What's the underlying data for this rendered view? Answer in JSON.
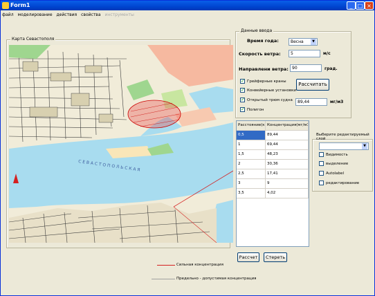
{
  "window": {
    "title": "Form1",
    "colors": {
      "titlebar": "#0a5fe8",
      "face": "#ece9d8"
    }
  },
  "menu": {
    "items": [
      "файл",
      "моделирование",
      "действия",
      "свойства"
    ],
    "disabled_item": "инструменты"
  },
  "map_panel": {
    "legend": "Карта Севастополя"
  },
  "input_panel": {
    "legend": "Данные ввода",
    "season_label": "Время года:",
    "season_value": "Весна",
    "wind_speed_label": "Скорость ветра:",
    "wind_speed_value": "5",
    "wind_speed_unit": "м/с",
    "wind_dir_label": "Направлени ветра:",
    "wind_dir_value": "90",
    "wind_dir_unit": "град.",
    "calc_button": "Рассчитать",
    "checkboxes": [
      {
        "label": "Грейферные краны",
        "checked": true
      },
      {
        "label": "Конвейерные установки",
        "checked": true
      },
      {
        "label": "Открытый трюм судна",
        "checked": true
      },
      {
        "label": "Полигон",
        "checked": true
      }
    ],
    "concentration_value": "89,44",
    "concentration_unit": "мг/м3"
  },
  "table": {
    "headers": [
      "Расстояние(км)",
      "Концентрация(мг/м3)"
    ],
    "rows": [
      [
        "0,5",
        "89,44"
      ],
      [
        "1",
        "69,44"
      ],
      [
        "1,5",
        "48,23"
      ],
      [
        "2",
        "30,36"
      ],
      [
        "2,5",
        "17,41"
      ],
      [
        "3",
        "9"
      ],
      [
        "3,5",
        "4,02"
      ]
    ]
  },
  "layers_panel": {
    "title": "Выберите редактируемый слой",
    "options": [
      {
        "label": "Видимость",
        "checked": false
      },
      {
        "label": "выделение",
        "checked": false
      },
      {
        "label": "Autolabel",
        "checked": false
      },
      {
        "label": "редактирование",
        "checked": false
      }
    ]
  },
  "buttons": {
    "calc": "Рассчет",
    "clear": "Стереть"
  },
  "legend": {
    "strong": "Сильная концентрация",
    "maximum": "Предельно - допустимая концентрация",
    "strong_color": "#d42020",
    "maximum_color": "#a0a0a0"
  }
}
